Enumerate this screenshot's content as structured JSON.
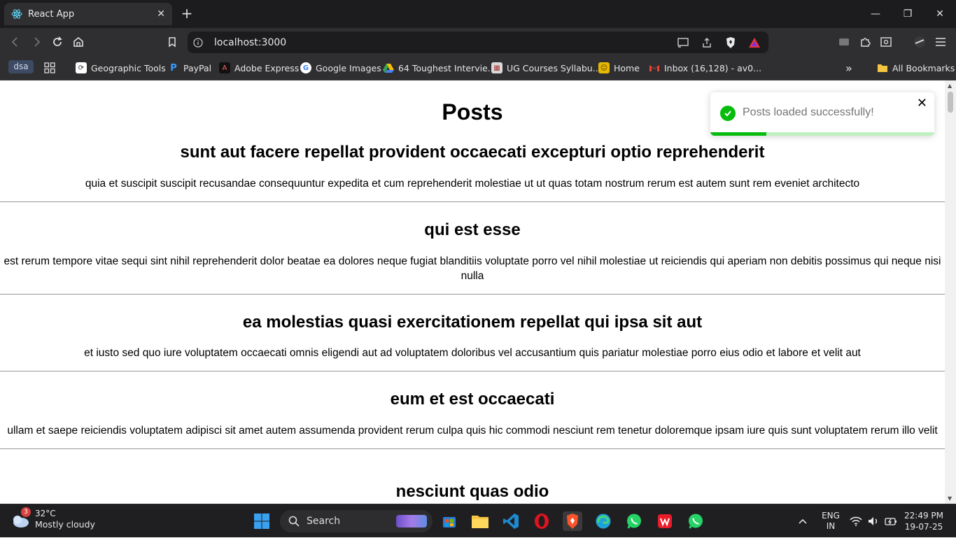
{
  "browser": {
    "tab_title": "React App",
    "url": "localhost:3000",
    "profile_badge": "dsa",
    "bookmarks": [
      {
        "label": "Geographic Tools",
        "color": "#ffffff"
      },
      {
        "label": "PayPal",
        "color": "#0070ba"
      },
      {
        "label": "Adobe Express",
        "color": "#1a1a1a"
      },
      {
        "label": "Google Images",
        "color": "#ffffff"
      },
      {
        "label": "64 Toughest Intervie...",
        "color": "#34a853"
      },
      {
        "label": "UG Courses Syllabu...",
        "color": "#d9d9d9"
      },
      {
        "label": "Home",
        "color": "#e6b800"
      },
      {
        "label": "Inbox (16,128) - av0...",
        "color": "#ea4335"
      }
    ],
    "more_bookmarks": "»",
    "all_bookmarks": "All Bookmarks"
  },
  "page": {
    "heading": "Posts",
    "posts": [
      {
        "title": "sunt aut facere repellat provident occaecati excepturi optio reprehenderit",
        "body": "quia et suscipit suscipit recusandae consequuntur expedita et cum reprehenderit molestiae ut ut quas totam nostrum rerum est autem sunt rem eveniet architecto"
      },
      {
        "title": "qui est esse",
        "body": "est rerum tempore vitae sequi sint nihil reprehenderit dolor beatae ea dolores neque fugiat blanditiis voluptate porro vel nihil molestiae ut reiciendis qui aperiam non debitis possimus qui neque nisi nulla"
      },
      {
        "title": "ea molestias quasi exercitationem repellat qui ipsa sit aut",
        "body": "et iusto sed quo iure voluptatem occaecati omnis eligendi aut ad voluptatem doloribus vel accusantium quis pariatur molestiae porro eius odio et labore et velit aut"
      },
      {
        "title": "eum et est occaecati",
        "body": "ullam et saepe reiciendis voluptatem adipisci sit amet autem assumenda provident rerum culpa quis hic commodi nesciunt rem tenetur doloremque ipsam iure quis sunt voluptatem rerum illo velit"
      },
      {
        "title": "nesciunt quas odio",
        "body": ""
      }
    ]
  },
  "toast": {
    "message": "Posts loaded successfully!",
    "progress": 0.25,
    "accent": "#07bc0c"
  },
  "taskbar": {
    "weather_badge": "3",
    "temperature": "32°C",
    "condition": "Mostly cloudy",
    "search_label": "Search",
    "lang_top": "ENG",
    "lang_bottom": "IN",
    "time": "22:49 PM",
    "date": "19-07-25"
  }
}
